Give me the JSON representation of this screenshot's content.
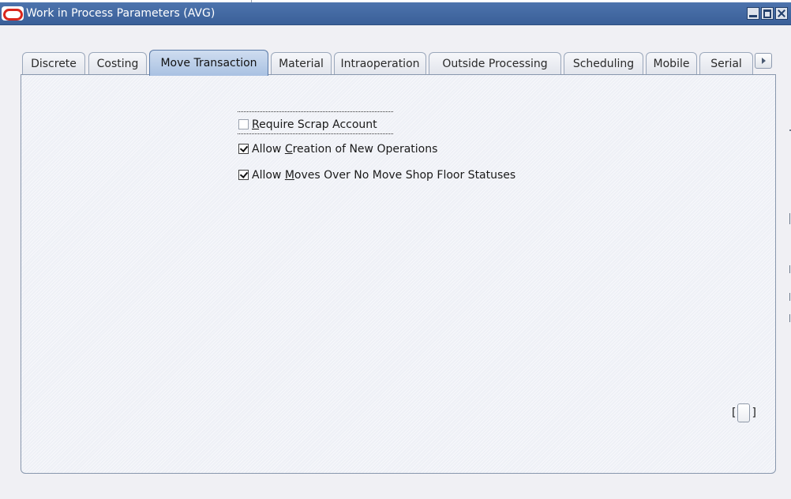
{
  "window": {
    "title": "Work in Process Parameters (AVG)"
  },
  "tabs": [
    {
      "label": "Discrete",
      "active": false
    },
    {
      "label": "Costing",
      "active": false
    },
    {
      "label": "Move Transaction",
      "active": true
    },
    {
      "label": "Material",
      "active": false
    },
    {
      "label": "Intraoperation",
      "active": false
    },
    {
      "label": "Outside Processing",
      "active": false
    },
    {
      "label": "Scheduling",
      "active": false
    },
    {
      "label": "Mobile",
      "active": false
    },
    {
      "label": "Serial",
      "active": false
    }
  ],
  "move_transaction": {
    "require_scrap_account": {
      "label_pre": "",
      "label_key": "R",
      "label_post": "equire Scrap Account",
      "checked": false
    },
    "allow_new_operations": {
      "label_pre": "Allow ",
      "label_key": "C",
      "label_post": "reation of New Operations",
      "checked": true
    },
    "allow_moves_over_no_move": {
      "label_pre": "Allow ",
      "label_key": "M",
      "label_post": "oves Over No Move Shop Floor Statuses",
      "checked": true
    }
  },
  "bracket_control": {
    "open": "[",
    "close": "]"
  },
  "colors": {
    "titlebar": "#3f66a1",
    "active_tab": "#b8cbe7",
    "logo_red": "#d9261c"
  },
  "icons": {
    "app": "oracle-logo-icon",
    "minimize": "minimize-icon",
    "maximize": "maximize-icon",
    "close": "close-icon",
    "tab_scroll": "chevron-right-icon"
  }
}
